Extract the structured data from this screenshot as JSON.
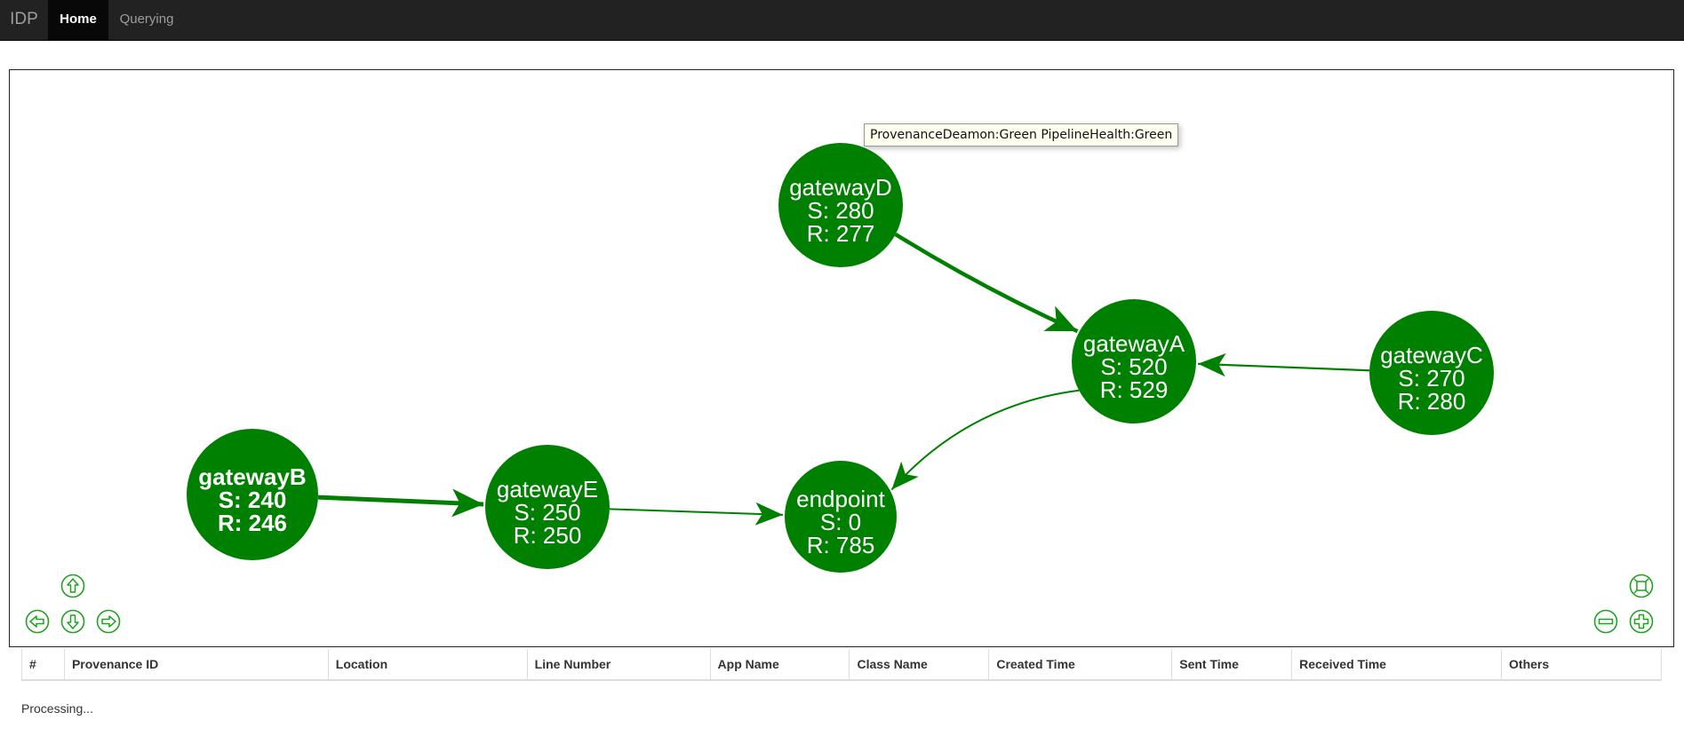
{
  "navbar": {
    "brand": "IDP",
    "items": [
      {
        "label": "Home",
        "active": true
      },
      {
        "label": "Querying",
        "active": false
      }
    ]
  },
  "graph": {
    "tooltip": "ProvenanceDeamon:Green PipelineHealth:Green",
    "node_color": "#008000",
    "nodes": [
      {
        "id": "gatewayD",
        "name": "gatewayD",
        "sent": "S: 280",
        "received": "R: 277",
        "bold": false
      },
      {
        "id": "gatewayA",
        "name": "gatewayA",
        "sent": "S: 520",
        "received": "R: 529",
        "bold": false
      },
      {
        "id": "gatewayC",
        "name": "gatewayC",
        "sent": "S: 270",
        "received": "R: 280",
        "bold": false
      },
      {
        "id": "gatewayB",
        "name": "gatewayB",
        "sent": "S: 240",
        "received": "R: 246",
        "bold": true
      },
      {
        "id": "gatewayE",
        "name": "gatewayE",
        "sent": "S: 250",
        "received": "R: 250",
        "bold": false
      },
      {
        "id": "endpoint",
        "name": "endpoint",
        "sent": "S: 0",
        "received": "R: 785",
        "bold": false
      }
    ],
    "edges": [
      {
        "from": "gatewayD",
        "to": "gatewayA"
      },
      {
        "from": "gatewayC",
        "to": "gatewayA"
      },
      {
        "from": "gatewayA",
        "to": "endpoint"
      },
      {
        "from": "gatewayB",
        "to": "gatewayE"
      },
      {
        "from": "gatewayE",
        "to": "endpoint"
      }
    ],
    "controls": {
      "up": "arrow-up-icon",
      "down": "arrow-down-icon",
      "left": "arrow-left-icon",
      "right": "arrow-right-icon",
      "fit": "zoom-extends-icon",
      "zoom_out": "zoom-out-icon",
      "zoom_in": "zoom-in-icon"
    }
  },
  "table": {
    "columns": [
      "#",
      "Provenance ID",
      "Location",
      "Line Number",
      "App Name",
      "Class Name",
      "Created Time",
      "Sent Time",
      "Received Time",
      "Others"
    ]
  },
  "status": "Processing..."
}
